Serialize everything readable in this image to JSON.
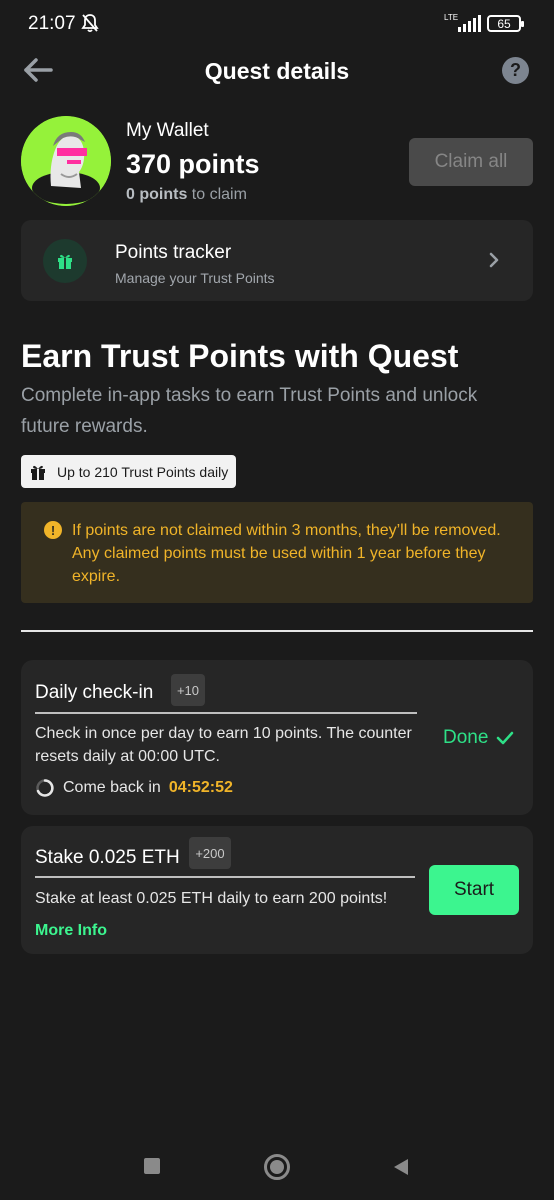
{
  "status_bar": {
    "time": "21:07",
    "network": "LTE",
    "battery": "65"
  },
  "header": {
    "title": "Quest details",
    "back_icon": "arrow-left-icon",
    "help_icon": "question-circle-icon",
    "help_glyph": "?"
  },
  "wallet": {
    "name": "My Wallet",
    "points": "370 points",
    "claim_count": "0 points",
    "claim_suffix": "to claim",
    "claim_button": "Claim all"
  },
  "tracker": {
    "title": "Points tracker",
    "subtitle": "Manage your Trust Points",
    "icon": "gift-icon"
  },
  "earn": {
    "title": "Earn Trust Points with Quest",
    "description": "Complete in-app tasks to earn Trust Points and unlock future rewards.",
    "badge": "Up to 210 Trust Points daily"
  },
  "warning": {
    "icon_glyph": "!",
    "text": "If points are not claimed within 3 months, they’ll be removed. Any claimed points must be used within 1 year before they expire."
  },
  "tasks": [
    {
      "title": "Daily check-in",
      "badge": "+10",
      "description": "Check in once per day to earn 10 points. The counter resets daily at 00:00 UTC.",
      "status": "Done",
      "countdown_label": "Come back in",
      "countdown": "04:52:52"
    },
    {
      "title": "Stake 0.025 ETH",
      "badge": "+200",
      "description": "Stake at least 0.025 ETH daily to earn 200 points!",
      "action": "Start",
      "link": "More Info"
    }
  ],
  "colors": {
    "accent_green": "#3cf58f",
    "warning_amber": "#f0b429",
    "background": "#1b1b1b",
    "card": "#262626"
  }
}
